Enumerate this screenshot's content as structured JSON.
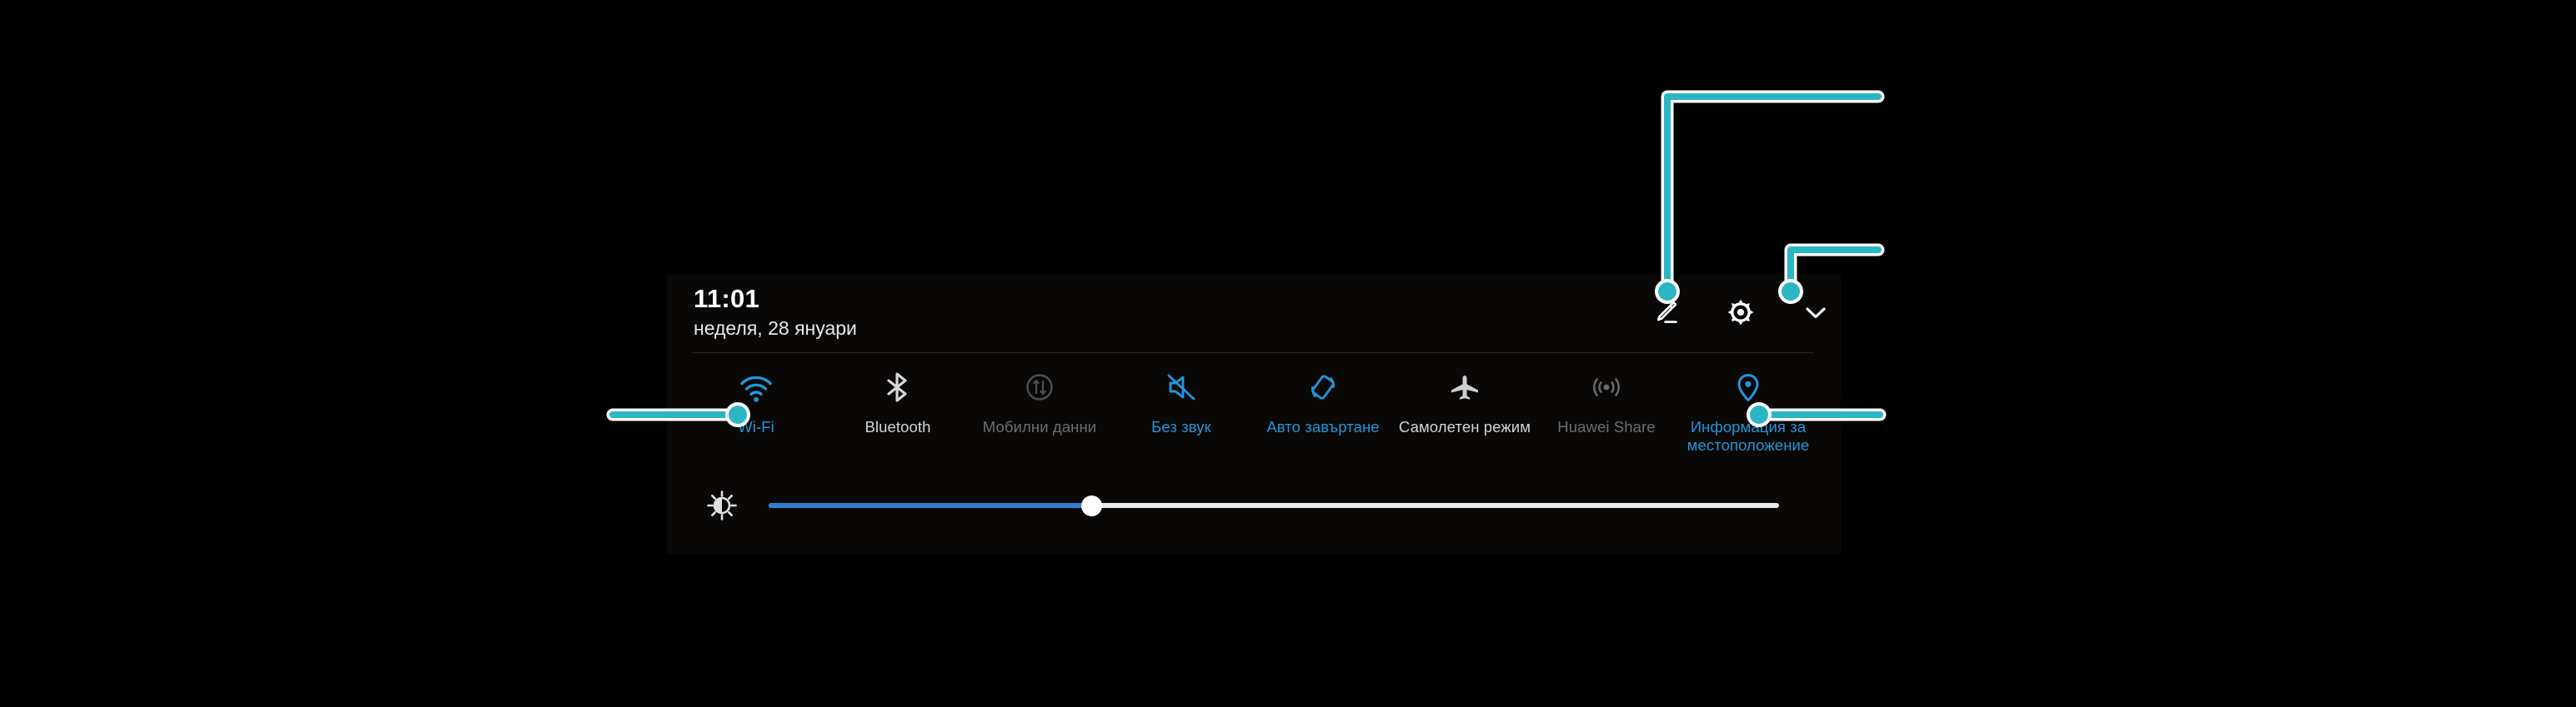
{
  "panel": {
    "kind": "android-quick-settings-shade",
    "background_color": "#0a0707"
  },
  "header": {
    "clock": "11:01",
    "date": "неделя, 28 януари",
    "actions": [
      {
        "name": "edit-button",
        "icon": "pencil-edit-icon",
        "color": "#ffffff"
      },
      {
        "name": "settings-button",
        "icon": "gear-icon",
        "color": "#ffffff"
      },
      {
        "name": "collapse-button",
        "icon": "chevron-down-icon",
        "color": "#ffffff"
      }
    ]
  },
  "colors": {
    "accent_on": "#2196d9",
    "label_off": "#d4d4d4",
    "label_dim": "#6e6e6e",
    "annotation": "#2bb6c4",
    "annotation_outline": "#ffffff",
    "slider_fill": "#2f7fd1",
    "slider_track": "#e9e9e9"
  },
  "toggles": [
    {
      "label": "Wi-Fi",
      "icon": "wifi-icon",
      "state": "on"
    },
    {
      "label": "Bluetooth",
      "icon": "bluetooth-icon",
      "state": "off"
    },
    {
      "label": "Мобилни данни",
      "icon": "mobile-data-icon",
      "state": "dim"
    },
    {
      "label": "Без звук",
      "icon": "mute-icon",
      "state": "on"
    },
    {
      "label": "Авто завъртане",
      "icon": "auto-rotate-icon",
      "state": "on"
    },
    {
      "label": "Самолетен режим",
      "icon": "airplane-mode-icon",
      "state": "off"
    },
    {
      "label": "Huawei Share",
      "icon": "huawei-share-icon",
      "state": "dim"
    },
    {
      "label": "Информация за\nместоположение",
      "icon": "location-pin-icon",
      "state": "on"
    }
  ],
  "brightness": {
    "icon": "brightness-icon",
    "value_percent": 32
  },
  "annotations": [
    {
      "name": "callout-wifi",
      "target": "Wi-Fi toggle"
    },
    {
      "name": "callout-location",
      "target": "Информация за местоположение toggle"
    },
    {
      "name": "callout-edit",
      "target": "edit button"
    },
    {
      "name": "callout-collapse",
      "target": "collapse button"
    }
  ]
}
